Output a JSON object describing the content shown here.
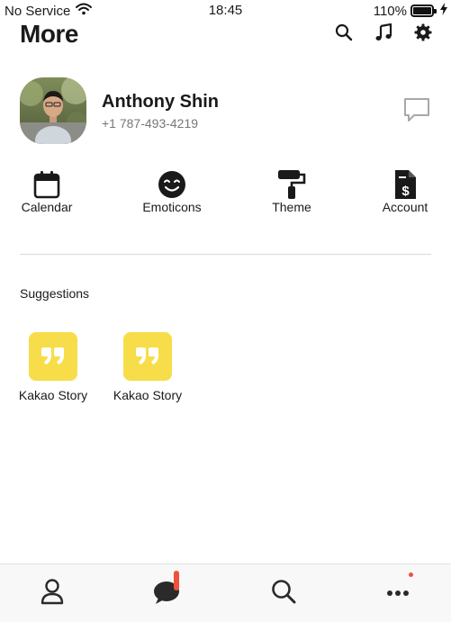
{
  "status_bar": {
    "carrier": "No Service",
    "time": "18:45",
    "battery": "110%"
  },
  "header": {
    "title": "More",
    "icons": [
      "search-icon",
      "music-note-icon",
      "gear-icon"
    ]
  },
  "profile": {
    "name": "Anthony Shin",
    "phone": "+1 787-493-4219",
    "icon": "chat-bubble-icon"
  },
  "shortcuts": [
    {
      "label": "Calendar",
      "icon": "calendar-icon"
    },
    {
      "label": "Emoticons",
      "icon": "smiley-icon"
    },
    {
      "label": "Theme",
      "icon": "paint-roller-icon"
    },
    {
      "label": "Account",
      "icon": "dollar-document-icon"
    }
  ],
  "suggestions": {
    "title": "Suggestions",
    "items": [
      {
        "label": "Kakao Story",
        "icon": "quote-icon"
      },
      {
        "label": "Kakao Story",
        "icon": "quote-icon"
      }
    ]
  },
  "tab_bar": {
    "tabs": [
      {
        "icon": "person-icon"
      },
      {
        "icon": "chat-icon"
      },
      {
        "icon": "search-icon"
      },
      {
        "icon": "more-icon"
      }
    ]
  },
  "colors": {
    "accent_yellow": "#f7dd4a",
    "badge_red": "#f0503c",
    "tab_bar_bg": "#f8f8f8"
  }
}
